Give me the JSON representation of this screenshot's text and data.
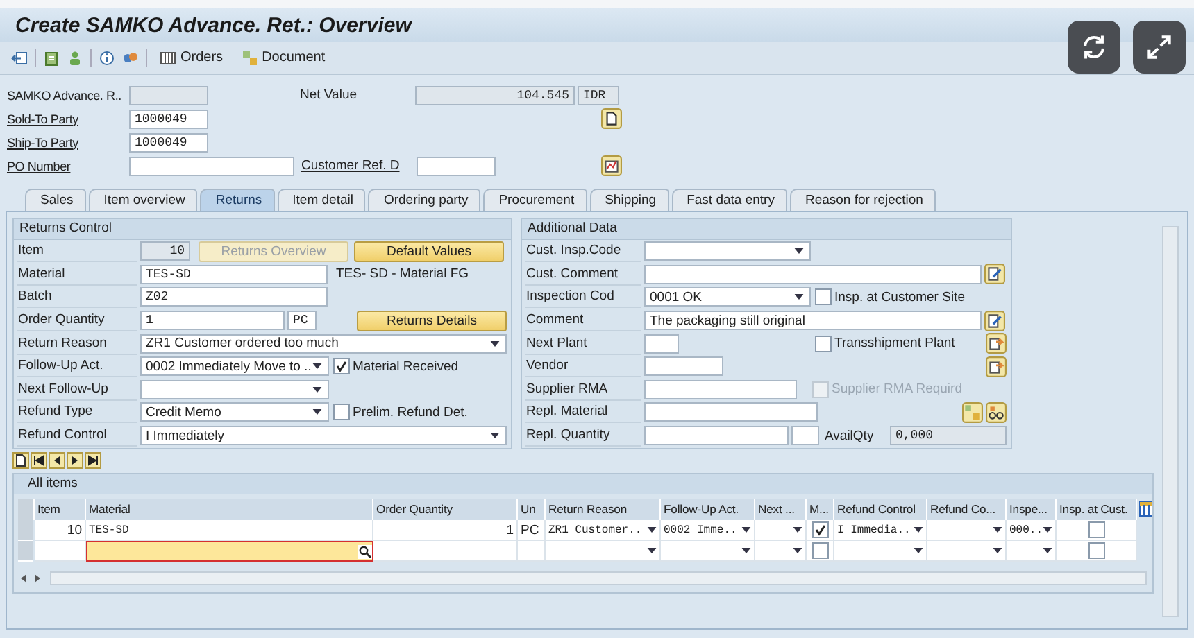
{
  "window": {
    "title": "Create SAMKO Advance. Ret.: Overview"
  },
  "toolbar": [
    {
      "label": "Orders",
      "kind": "grid"
    },
    {
      "label": "Document",
      "kind": "doc"
    }
  ],
  "header": {
    "doc_label": "SAMKO Advance. R..",
    "net_value_label": "Net Value",
    "net_value": "104.545",
    "currency": "IDR",
    "sold_to_label": "Sold-To Party",
    "sold_to": "1000049",
    "ship_to_label": "Ship-To Party",
    "ship_to": "1000049",
    "po_label": "PO Number",
    "customer_ref_label": "Customer Ref. D"
  },
  "tabs": [
    {
      "label": "Sales",
      "selected": false
    },
    {
      "label": "Item overview",
      "selected": false
    },
    {
      "label": "Returns",
      "selected": true
    },
    {
      "label": "Item detail",
      "selected": false
    },
    {
      "label": "Ordering party",
      "selected": false
    },
    {
      "label": "Procurement",
      "selected": false
    },
    {
      "label": "Shipping",
      "selected": false
    },
    {
      "label": "Fast data entry",
      "selected": false
    },
    {
      "label": "Reason for rejection",
      "selected": false
    }
  ],
  "returns_control": {
    "title": "Returns Control",
    "item": {
      "label": "Item",
      "value": "10"
    },
    "returns_overview": {
      "label": "Returns Overview",
      "disabled": true
    },
    "default_values": {
      "label": "Default Values",
      "disabled": false
    },
    "material": {
      "label": "Material",
      "value": "TES-SD",
      "description": "TES- SD - Material FG"
    },
    "batch": {
      "label": "Batch",
      "value": "Z02"
    },
    "order_quantity": {
      "label": "Order Quantity",
      "value": "1",
      "unit": "PC"
    },
    "returns_details": {
      "label": "Returns Details",
      "disabled": false
    },
    "return_reason": {
      "label": "Return Reason",
      "value": "ZR1 Customer ordered too much"
    },
    "follow_up": {
      "label": "Follow-Up Act.",
      "value": "0002 Immediately Move to ..",
      "checkbox": {
        "label": "Material Received",
        "checked": true
      }
    },
    "next_follow_up": {
      "label": "Next Follow-Up"
    },
    "refund_type": {
      "label": "Refund Type",
      "value": "Credit Memo",
      "checkbox": {
        "label": "Prelim. Refund Det.",
        "checked": false
      }
    },
    "refund_control": {
      "label": "Refund Control",
      "value": "I Immediately"
    }
  },
  "additional_data": {
    "title": "Additional Data",
    "cust_insp_code": {
      "label": "Cust. Insp.Code"
    },
    "cust_comment": {
      "label": "Cust. Comment"
    },
    "inspection_code": {
      "label": "Inspection Cod",
      "value": "0001 OK",
      "checkbox": {
        "label": "Insp. at Customer Site",
        "checked": false,
        "disabled": false
      }
    },
    "comment": {
      "label": "Comment",
      "value": "The packaging still original"
    },
    "next_plant": {
      "label": "Next Plant",
      "checkbox": {
        "label": "Transshipment Plant",
        "checked": false,
        "disabled": false
      }
    },
    "vendor": {
      "label": "Vendor"
    },
    "supplier_rma": {
      "label": "Supplier RMA",
      "checkbox": {
        "label": "Supplier RMA Requird",
        "checked": false,
        "disabled": true
      }
    },
    "repl_material": {
      "label": "Repl. Material"
    },
    "repl_quantity": {
      "label": "Repl. Quantity",
      "avail_label": "AvailQty",
      "avail_value": "0,000"
    }
  },
  "items_table": {
    "title": "All items",
    "columns": [
      {
        "label": "Item",
        "kind": "number"
      },
      {
        "label": "Material",
        "kind": "input"
      },
      {
        "label": "Order Quantity",
        "kind": "number"
      },
      {
        "label": "Un",
        "kind": "text"
      },
      {
        "label": "Return Reason",
        "kind": "select"
      },
      {
        "label": "Follow-Up Act.",
        "kind": "select"
      },
      {
        "label": "Next ...",
        "kind": "select"
      },
      {
        "label": "M...",
        "kind": "check"
      },
      {
        "label": "Refund Control",
        "kind": "select"
      },
      {
        "label": "Refund Co...",
        "kind": "select"
      },
      {
        "label": "Inspe...",
        "kind": "select"
      },
      {
        "label": "Insp. at Cust.",
        "kind": "check"
      }
    ],
    "rows": [
      {
        "focused": false,
        "cells": [
          "10",
          "TES-SD",
          "1",
          "PC",
          "ZR1 Customer..",
          "0002 Imme..",
          null,
          true,
          "I Immedia..",
          null,
          "000..",
          false
        ]
      },
      {
        "focused": true,
        "cells": [
          null,
          null,
          null,
          null,
          null,
          null,
          null,
          false,
          null,
          null,
          null,
          false
        ]
      }
    ]
  }
}
